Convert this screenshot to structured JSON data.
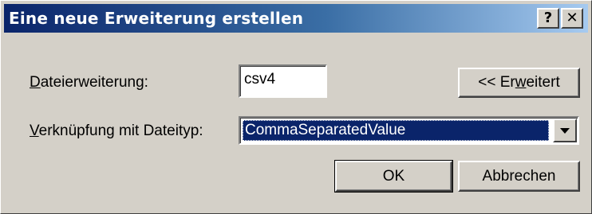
{
  "dialog": {
    "title": "Eine neue Erweiterung erstellen",
    "help_button": "?",
    "close_button": "✕"
  },
  "form": {
    "extension_label": "Dateierweiterung:",
    "extension_label_first": "D",
    "extension_label_rest": "ateierweiterung:",
    "extension_value": "csv4",
    "association_label_first": "V",
    "association_label_rest": "erknüpfung mit Dateityp:",
    "association_value": "CommaSeparatedValue"
  },
  "buttons": {
    "advanced_pre": "<< Er",
    "advanced_mnemonic": "w",
    "advanced_post": "eitert",
    "ok": "OK",
    "cancel": "Abbrechen"
  },
  "icons": {
    "dropdown": "chevron-down-icon",
    "help": "help-icon",
    "close": "close-icon"
  }
}
